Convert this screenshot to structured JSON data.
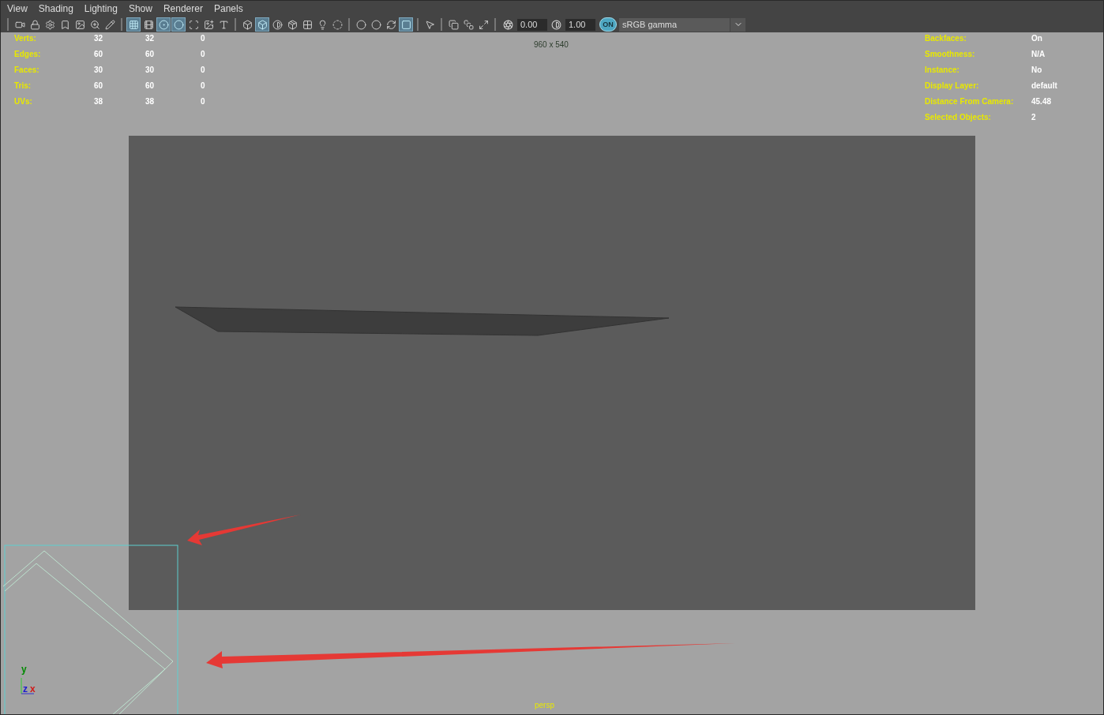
{
  "menu": [
    {
      "label": "View"
    },
    {
      "label": "Shading"
    },
    {
      "label": "Lighting"
    },
    {
      "label": "Show"
    },
    {
      "label": "Renderer"
    },
    {
      "label": "Panels"
    }
  ],
  "toolbar": {
    "buttons": [
      {
        "on": false
      },
      {
        "on": false
      },
      {
        "on": false
      },
      {
        "on": false
      },
      {
        "on": false
      },
      {
        "on": false
      },
      {
        "on": false
      },
      {
        "on": true
      },
      {
        "on": false
      },
      {
        "on": true
      },
      {
        "on": true
      },
      {
        "on": false
      },
      {
        "on": false
      },
      {
        "on": false
      },
      {
        "on": false
      },
      {
        "on": true
      },
      {
        "on": false
      },
      {
        "on": false
      },
      {
        "on": false
      },
      {
        "on": false
      },
      {
        "on": false
      },
      {
        "on": false
      },
      {
        "on": false
      },
      {
        "on": false
      },
      {
        "on": true
      },
      {
        "on": false
      },
      {
        "on": false
      },
      {
        "on": false
      },
      {
        "on": false
      }
    ],
    "exposure": "0.00",
    "gamma": "1.00",
    "color_management": {
      "label": "ON",
      "on": true
    },
    "view_transform": "sRGB gamma"
  },
  "hud": {
    "resolution": "960 x 540",
    "poly_stats": [
      {
        "label": "Verts:",
        "values": [
          "32",
          "32",
          "0"
        ]
      },
      {
        "label": "Edges:",
        "values": [
          "60",
          "60",
          "0"
        ]
      },
      {
        "label": "Faces:",
        "values": [
          "30",
          "30",
          "0"
        ]
      },
      {
        "label": "Tris:",
        "values": [
          "60",
          "60",
          "0"
        ]
      },
      {
        "label": "UVs:",
        "values": [
          "38",
          "38",
          "0"
        ]
      }
    ],
    "object_info": [
      {
        "label": "Backfaces:",
        "value": "On"
      },
      {
        "label": "Smoothness:",
        "value": "N/A"
      },
      {
        "label": "Instance:",
        "value": "No"
      },
      {
        "label": "Display Layer:",
        "value": "default"
      },
      {
        "label": "Distance From Camera:",
        "value": "45.48"
      },
      {
        "label": "Selected Objects:",
        "value": "2"
      }
    ],
    "camera": "persp",
    "axes": [
      {
        "label": "y",
        "color": "#008a00"
      },
      {
        "label": "z",
        "color": "#1a1ad0"
      },
      {
        "label": "x",
        "color": "#d01a1a"
      }
    ]
  }
}
